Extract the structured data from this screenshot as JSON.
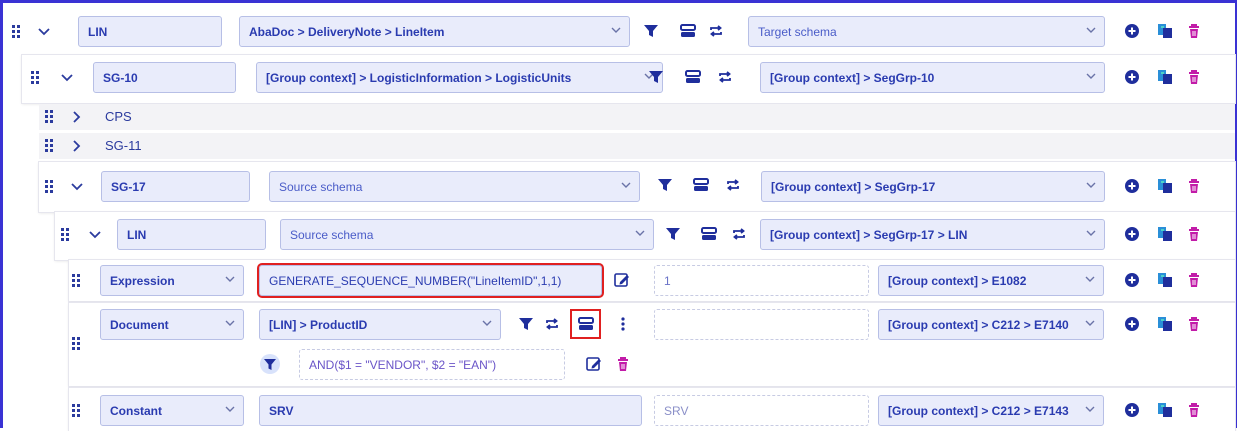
{
  "rows": {
    "r1": {
      "name": "LIN",
      "source": "AbaDoc > DeliveryNote > LineItem",
      "target": "Target schema"
    },
    "r2": {
      "name": "SG-10",
      "source": "[Group context] > LogisticInformation > LogisticUnits",
      "target": "[Group context] > SegGrp-10"
    },
    "r3": {
      "name": "CPS"
    },
    "r4": {
      "name": "SG-11"
    },
    "r5": {
      "name": "SG-17",
      "source": "Source schema",
      "target": "[Group context] > SegGrp-17"
    },
    "r6": {
      "name": "LIN",
      "source": "Source schema",
      "target": "[Group context] > SegGrp-17 > LIN"
    },
    "r7": {
      "type": "Expression",
      "expression": "GENERATE_SEQUENCE_NUMBER(\"LineItemID\",1,1)",
      "value": "1",
      "target": "[Group context] > E1082"
    },
    "r8": {
      "type": "Document",
      "source": "[LIN] > ProductID",
      "value": "",
      "target": "[Group context] > C212 > E7140",
      "filter": "AND($1 = \"VENDOR\", $2 = \"EAN\")"
    },
    "r9": {
      "type": "Constant",
      "constant": "SRV",
      "value": "SRV",
      "target": "[Group context] > C212 > E7143"
    }
  },
  "icons": {
    "handle": "drag-handle-icon",
    "expand": "chevron-down-icon",
    "collapse": "chevron-right-icon",
    "filter": "filter-icon",
    "schema": "schema-toggle-icon",
    "swap": "swap-icon",
    "add": "add-icon",
    "copy": "copy-icon",
    "delete": "trash-icon",
    "edit": "edit-icon",
    "more": "more-vertical-icon"
  },
  "colors": {
    "accent": "#2a3bb0",
    "field_bg": "#e9ecfb",
    "delete": "#c21ba8",
    "highlight": "#e02020",
    "frame": "#3a32d4"
  }
}
